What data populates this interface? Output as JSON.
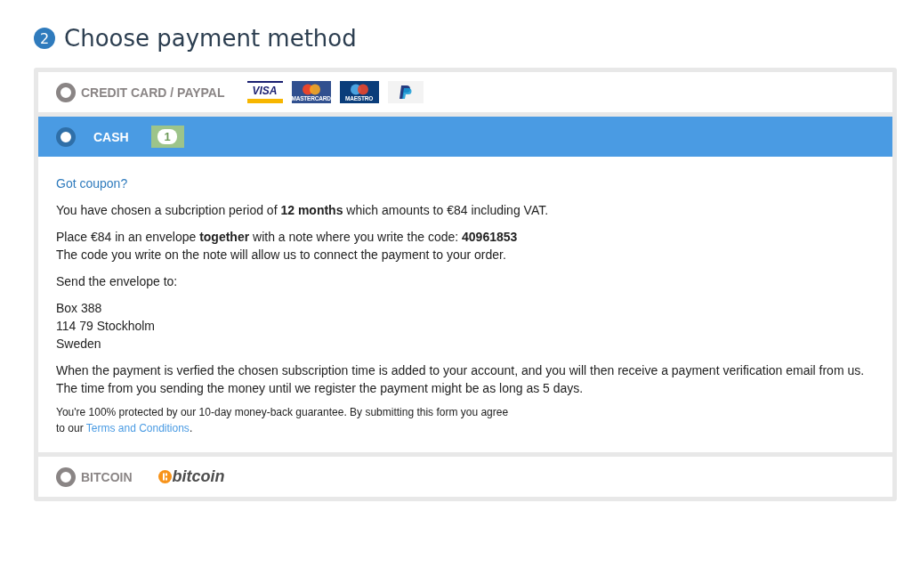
{
  "step": {
    "number": "2",
    "title": "Choose payment method"
  },
  "methods": [
    {
      "label": "CREDIT CARD / PAYPAL",
      "selected": false,
      "logos": [
        {
          "kind": "visa",
          "text": "VISA"
        },
        {
          "kind": "mastercard",
          "text": "MASTERCARD"
        },
        {
          "kind": "maestro",
          "text": "MAESTRO"
        },
        {
          "kind": "paypal"
        }
      ]
    },
    {
      "label": "CASH",
      "selected": true,
      "logos": [
        {
          "kind": "bill",
          "text": "1"
        }
      ],
      "details": {
        "coupon_link": "Got coupon?",
        "paragraphs": [
          [
            "You have chosen a subcription period of **12 months** which amounts to €84 including VAT."
          ],
          [
            "Place €84 in an envelope **together** with a note where you write the code: **40961853**",
            "The code you write on the note will allow us to connect the payment to your order."
          ],
          [
            "Send the envelope to:"
          ],
          [
            "Box 388",
            "114 79 Stockholm",
            "Sweden"
          ],
          [
            "When the payment is verfied the chosen subscription time is added to your account, and you will then receive a payment verification email from us.",
            "The time from you sending the money until we register the payment might be as long as 5 days."
          ]
        ],
        "legal": {
          "text": "You're 100% protected by our 10-day money-back guarantee. By submitting this form you agree",
          "prefix": "to our ",
          "link": "Terms and Conditions",
          "suffix": "."
        }
      }
    },
    {
      "label": "BITCOIN",
      "selected": false,
      "logos": [
        {
          "kind": "bitcoin",
          "text": "bitcoin"
        }
      ]
    }
  ]
}
